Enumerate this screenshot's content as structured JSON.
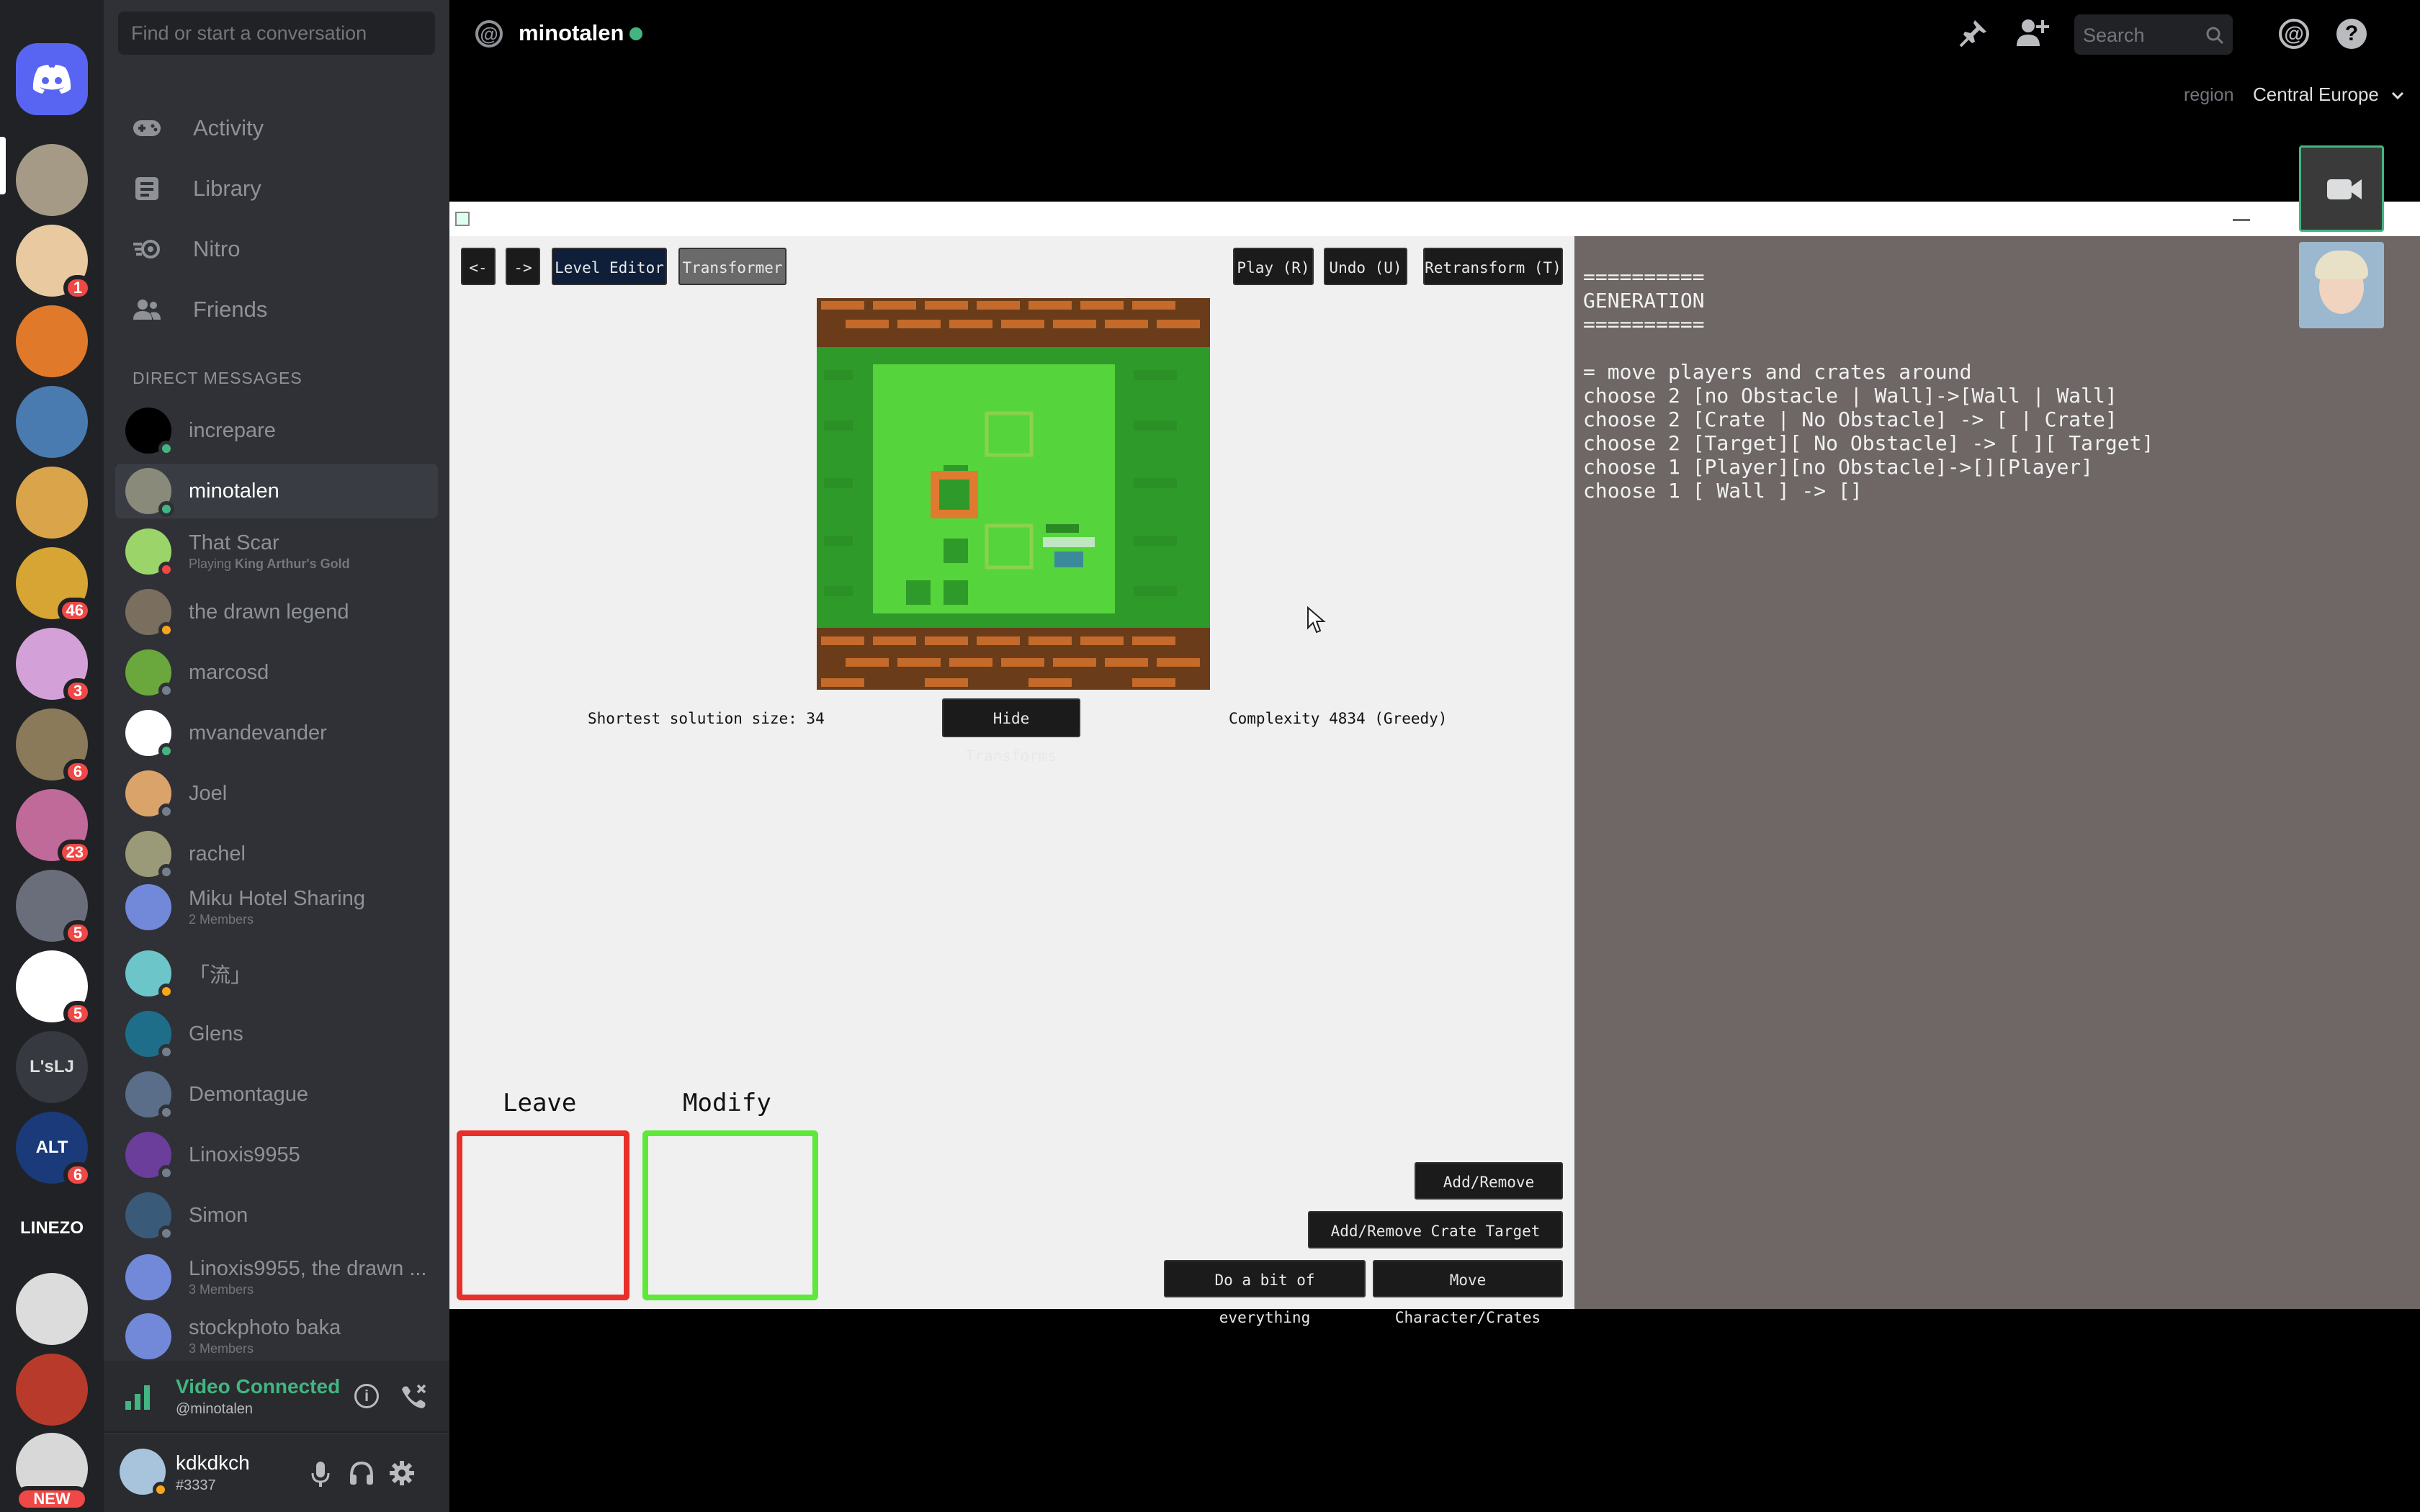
{
  "sidebar": {
    "search_placeholder": "Find or start a conversation",
    "nav": [
      {
        "label": "Activity",
        "icon": "gamepad-icon"
      },
      {
        "label": "Library",
        "icon": "library-icon"
      },
      {
        "label": "Nitro",
        "icon": "nitro-icon"
      },
      {
        "label": "Friends",
        "icon": "friends-icon"
      }
    ],
    "dm_header": "DIRECT MESSAGES",
    "dms": [
      {
        "name": "increpare",
        "sub": "",
        "status": "#43b581",
        "color": "#000000"
      },
      {
        "name": "minotalen",
        "sub": "",
        "status": "#43b581",
        "color": "#8a8a7a"
      },
      {
        "name": "That Scar",
        "sub_pre": "Playing ",
        "sub_bold": "King Arthur's Gold",
        "status": "#f04747",
        "color": "#9bd56a"
      },
      {
        "name": "the drawn legend",
        "sub": "",
        "status": "#faa61a",
        "color": "#7a6e5e"
      },
      {
        "name": "marcosd",
        "sub": "",
        "status": "#747f8d",
        "color": "#6aa83e"
      },
      {
        "name": "mvandevander",
        "sub": "",
        "status": "#43b581",
        "color": "#ffffff"
      },
      {
        "name": "Joel",
        "sub": "",
        "status": "#747f8d",
        "color": "#d9a36a"
      },
      {
        "name": "rachel",
        "sub": "",
        "status": "#747f8d",
        "color": "#9a9a78"
      },
      {
        "name": "Miku Hotel Sharing",
        "sub": "2 Members",
        "status": "",
        "color": "#ffffff"
      },
      {
        "name": "「流」",
        "sub": "",
        "status": "#faa61a",
        "color": "#6cc6c9"
      },
      {
        "name": "Glens",
        "sub": "",
        "status": "#747f8d",
        "color": "#1e6e8a"
      },
      {
        "name": "Demontague",
        "sub": "",
        "status": "#747f8d",
        "color": "#5a6e8a"
      },
      {
        "name": "Linoxis9955",
        "sub": "",
        "status": "#747f8d",
        "color": "#6a3e9a"
      },
      {
        "name": "Simon",
        "sub": "",
        "status": "#747f8d",
        "color": "#3a5a7a"
      },
      {
        "name": "Linoxis9955, the drawn ...",
        "sub": "3 Members",
        "status": "",
        "color": "#ffffff"
      },
      {
        "name": "stockphoto baka",
        "sub": "3 Members",
        "status": "",
        "color": "#ffffff"
      }
    ],
    "voice": {
      "title": "Video Connected",
      "sub": "@minotalen"
    },
    "user": {
      "name": "kdkdkch",
      "tag": "#3337"
    }
  },
  "servers": [
    {
      "badge": "",
      "color": "#5865f2"
    },
    {
      "badge": "",
      "color": "#a59a85"
    },
    {
      "badge": "1",
      "color": "#e8c9a0"
    },
    {
      "badge": "",
      "color": "#e07a2a"
    },
    {
      "badge": "",
      "color": "#4a7bb0"
    },
    {
      "badge": "",
      "color": "#d9a44a"
    },
    {
      "badge": "46",
      "color": "#d7a533"
    },
    {
      "badge": "3",
      "color": "#d4a0d8"
    },
    {
      "badge": "6",
      "color": "#8a7a5a"
    },
    {
      "badge": "23",
      "color": "#c06a9a"
    },
    {
      "badge": "5",
      "color": "#6a6e7a"
    },
    {
      "badge": "5",
      "color": "#ffffff"
    },
    {
      "badge": "",
      "color": "#36393f",
      "text": "L'sLJ"
    },
    {
      "badge": "6",
      "color": "#1a3a7a",
      "text": "ALT"
    },
    {
      "badge": "",
      "color": "#202225",
      "text": "LINEZO"
    },
    {
      "badge": "",
      "color": "#dcdcdc"
    },
    {
      "badge": "",
      "color": "#b83a2a"
    },
    {
      "badge": "NEW",
      "color": "#d8d8d8"
    }
  ],
  "topbar": {
    "channel": "minotalen",
    "search_placeholder": "Search",
    "region_label": "region",
    "region_value": "Central Europe"
  },
  "game": {
    "nav_buttons": [
      "<-",
      "->",
      "Level Editor",
      "Transformer"
    ],
    "action_buttons": [
      "Play (R)",
      "Undo (U)",
      "Retransform (T)"
    ],
    "shortest_solution": "Shortest solution size: 34",
    "hide_transforms": "Hide Transforms",
    "complexity": "Complexity 4834 (Greedy)",
    "leave_label": "Leave",
    "modify_label": "Modify",
    "bottom_buttons": [
      "Add/Remove Walls",
      "Add/Remove Crate Target Pairs",
      "Do a bit of everything",
      "Move Character/Crates"
    ],
    "panel_text": "==========\nGENERATION\n==========\n\n= move players and crates around\nchoose 2 [no Obstacle | Wall]->[Wall | Wall]\nchoose 2 [Crate | No Obstacle] -> [ | Crate]\nchoose 2 [Target][ No Obstacle] -> [ ][ Target]\nchoose 1 [Player][no Obstacle]->[][Player]\nchoose 1 [ Wall ] -> []"
  },
  "colors": {
    "accent": "#5865f2",
    "online": "#43b581",
    "idle": "#faa61a",
    "dnd": "#f04747",
    "leave_border": "#e8302a",
    "modify_border": "#5ee83a"
  }
}
